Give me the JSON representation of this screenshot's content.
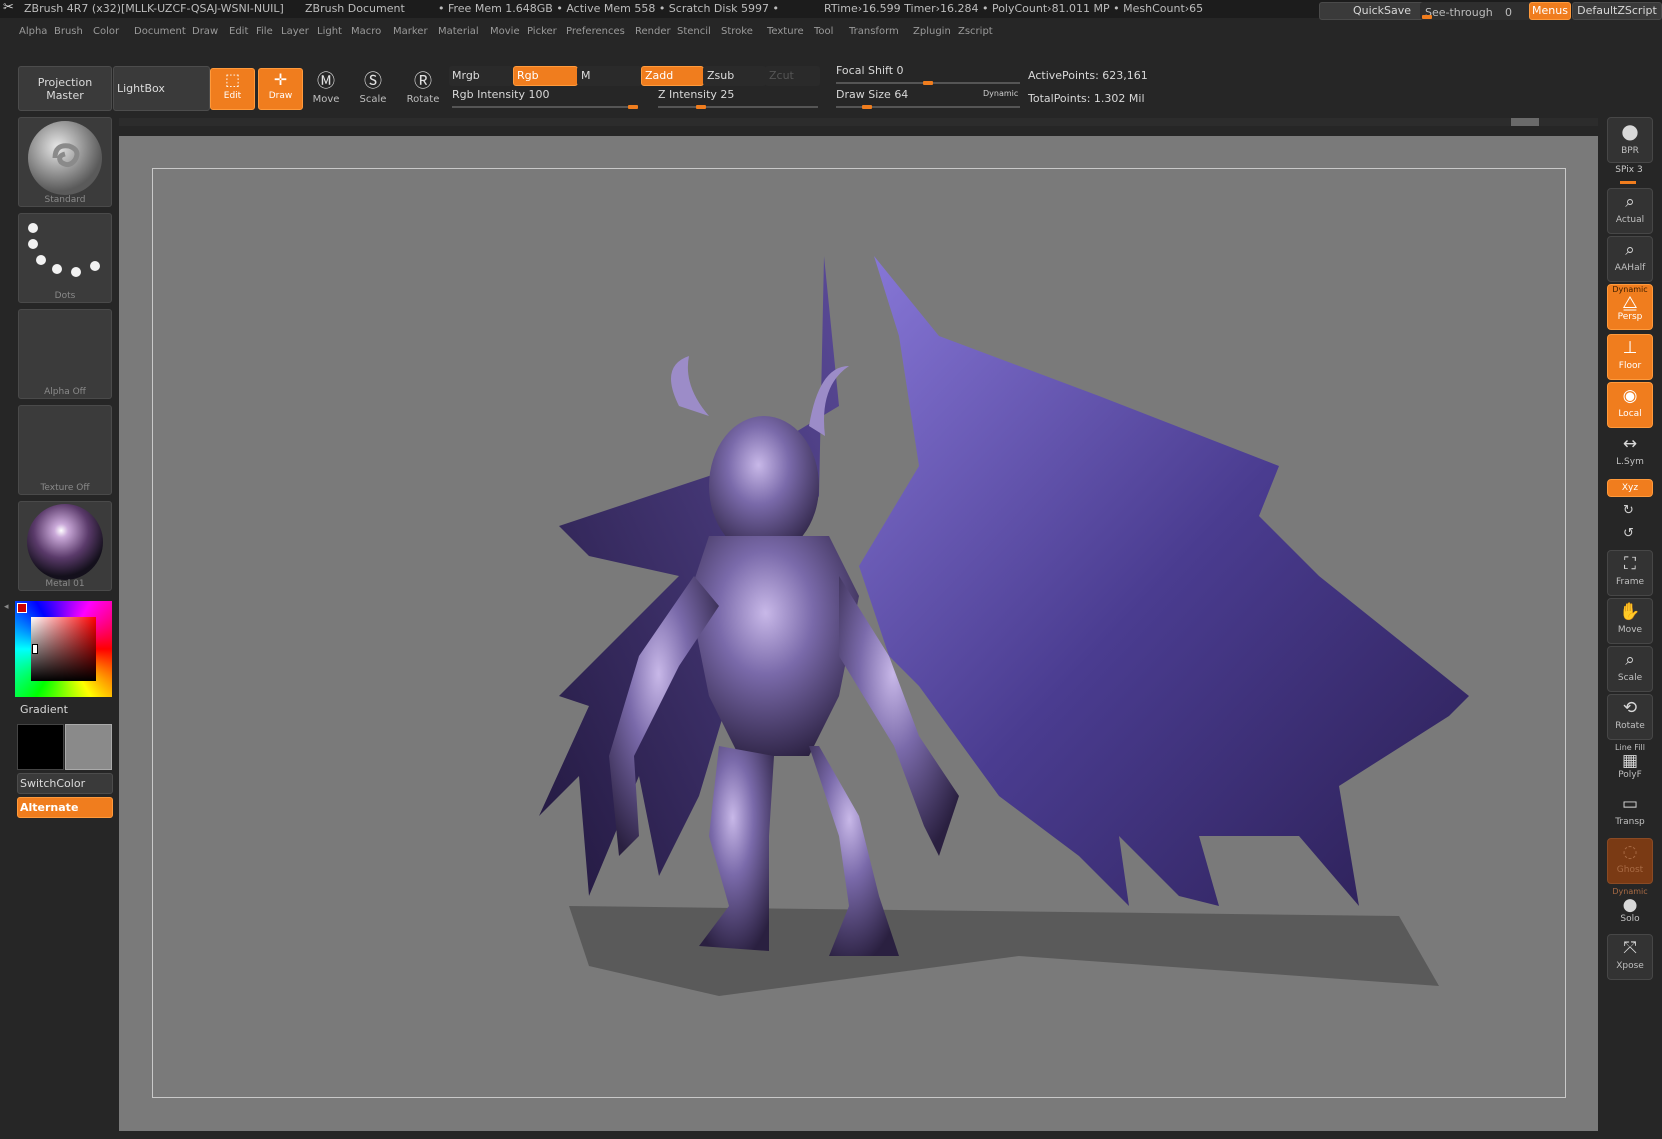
{
  "title_bar": {
    "app_title": "ZBrush 4R7 (x32)[MLLK-UZCF-QSAJ-WSNI-NUIL]",
    "document_title": "ZBrush Document",
    "stats": "• Free Mem 1.648GB • Active Mem 558 • Scratch Disk 5997 •",
    "times": "RTime›16.599 Timer›16.284 • PolyCount›81.011 MP • MeshCount›65",
    "quicksave_label": "QuickSave",
    "seethrough_label": "See-through",
    "seethrough_value": "0",
    "menus_label": "Menus",
    "script_label": "DefaultZScript"
  },
  "menu_bar": {
    "items": [
      "Alpha",
      "Brush",
      "Color",
      "Document",
      "Draw",
      "Edit",
      "File",
      "Layer",
      "Light",
      "Macro",
      "Marker",
      "Material",
      "Movie",
      "Picker",
      "Preferences",
      "Render",
      "Stencil",
      "Stroke",
      "Texture",
      "Tool",
      "Transform",
      "Zplugin",
      "Zscript"
    ]
  },
  "top_shelf": {
    "projection_master_line1": "Projection",
    "projection_master_line2": "Master",
    "lightbox_label": "LightBox",
    "edit_label": "Edit",
    "draw_label": "Draw",
    "move_label": "Move",
    "scale_label": "Scale",
    "rotate_label": "Rotate",
    "mrgb_label": "Mrgb",
    "rgb_label": "Rgb",
    "m_label": "M",
    "zadd_label": "Zadd",
    "zsub_label": "Zsub",
    "zcut_label": "Zcut",
    "rgb_intensity_label": "Rgb Intensity",
    "rgb_intensity_value": "100",
    "z_intensity_label": "Z Intensity",
    "z_intensity_value": "25",
    "focal_shift_label": "Focal Shift",
    "focal_shift_value": "0",
    "draw_size_label": "Draw Size",
    "draw_size_value": "64",
    "dynamic_label": "Dynamic",
    "active_points": "ActivePoints: 623,161",
    "total_points": "TotalPoints: 1.302 Mil",
    "rgb_intensity_fraction": 1.0,
    "z_intensity_fraction": 0.25,
    "focal_shift_fraction": 0.5,
    "draw_size_fraction": 0.15
  },
  "left_tray": {
    "brush_caption": "Standard",
    "stroke_caption": "Dots",
    "alpha_caption": "Alpha Off",
    "texture_caption": "Texture Off",
    "material_caption": "Metal 01",
    "gradient_label": "Gradient",
    "switchcolor_label": "SwitchColor",
    "alternate_label": "Alternate",
    "main_color": "#000000",
    "secondary_color": "#8a8a8a"
  },
  "right_shelf": {
    "bpr_label": "BPR",
    "spix_label": "SPix",
    "spix_value": "3",
    "actual_label": "Actual",
    "aahalf_label": "AAHalf",
    "dynamic_label": "Dynamic",
    "persp_label": "Persp",
    "floor_label": "Floor",
    "local_label": "Local",
    "lsym_label": "L.Sym",
    "xyz_label": "Xyz",
    "frame_label": "Frame",
    "move_label": "Move",
    "scale_label": "Scale",
    "rotate_label": "Rotate",
    "linefill_label": "Line Fill",
    "polyf_label": "PolyF",
    "transp_label": "Transp",
    "ghost_label": "Ghost",
    "dynamic2_label": "Dynamic",
    "solo_label": "Solo",
    "xpose_label": "Xpose"
  },
  "colors": {
    "accent": "#f07d1e",
    "ui_dark": "#262626",
    "canvas_bg": "#7a7a7a",
    "model": "#6a5ab4"
  }
}
